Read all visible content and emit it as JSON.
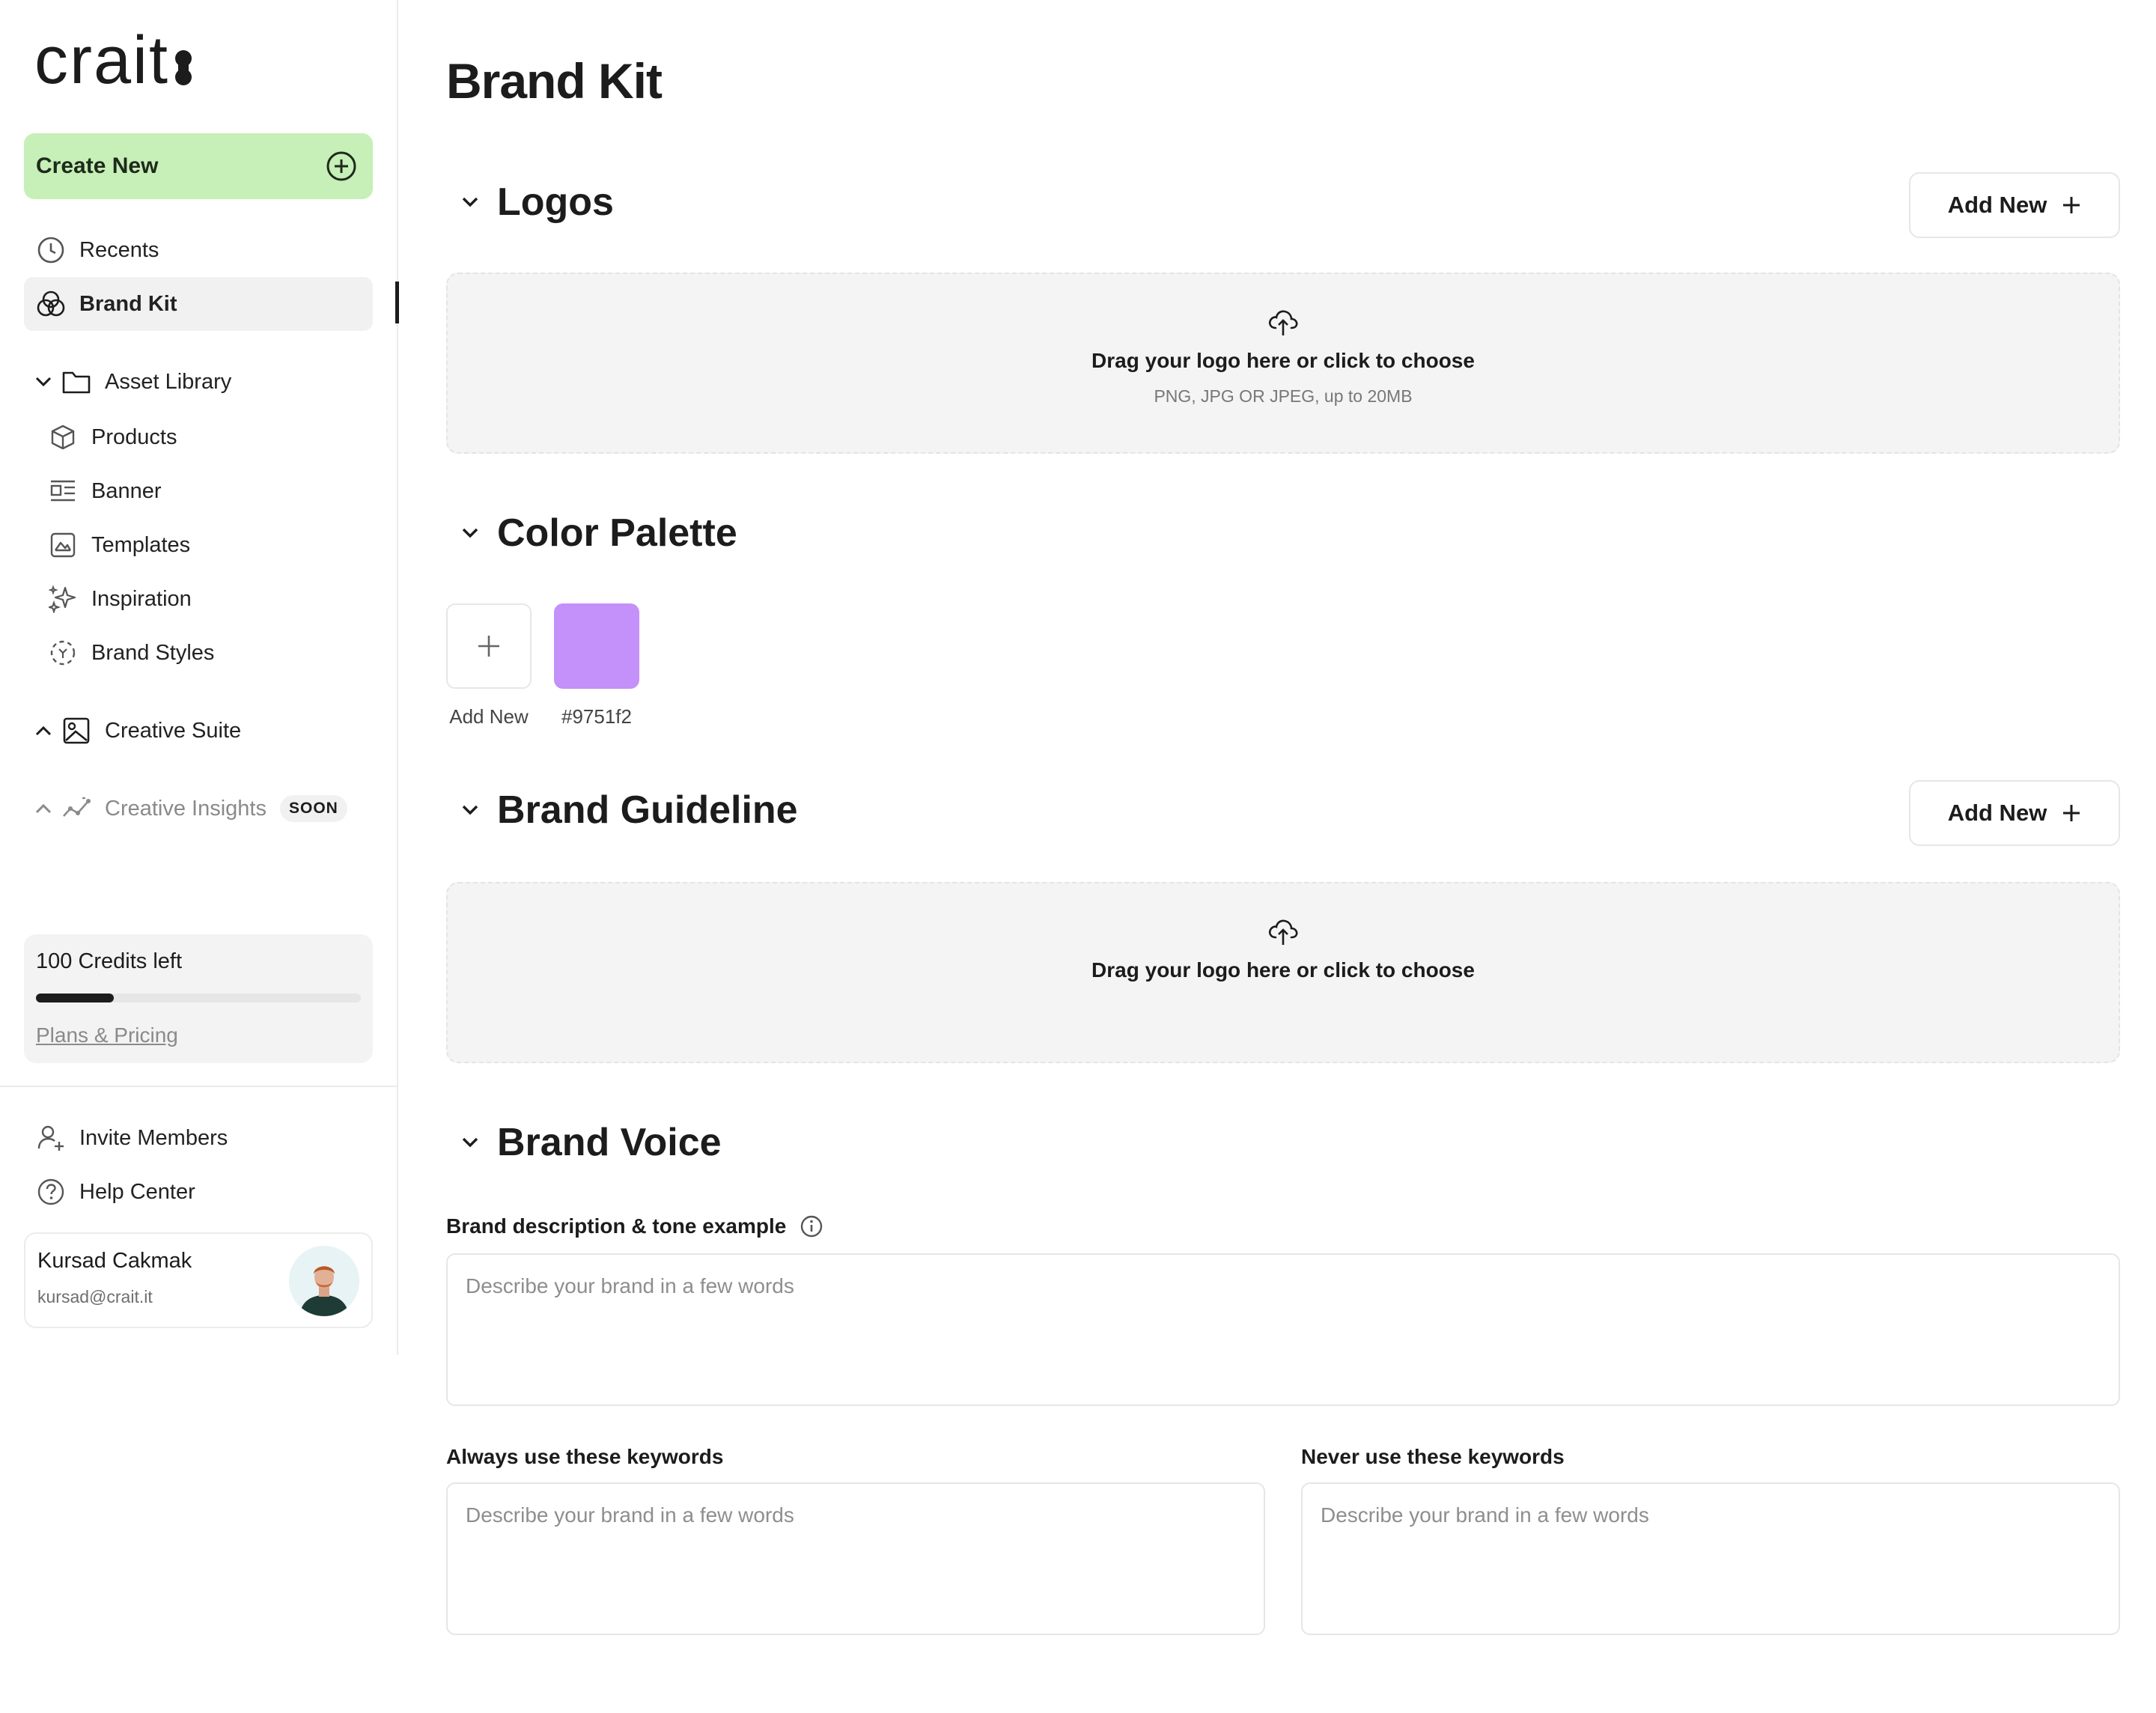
{
  "brand": {
    "logo_text": "crait"
  },
  "sidebar": {
    "create_new": "Create New",
    "nav": {
      "recents": "Recents",
      "brand_kit": "Brand Kit",
      "asset_library": "Asset Library",
      "products": "Products",
      "banner": "Banner",
      "templates": "Templates",
      "inspiration": "Inspiration",
      "brand_styles": "Brand Styles",
      "creative_suite": "Creative Suite",
      "creative_insights": "Creative Insights",
      "soon_badge": "SOON"
    },
    "credits": {
      "text": "100 Credits left",
      "used_fraction": 0.24,
      "plans_link": "Plans & Pricing"
    },
    "footer": {
      "invite": "Invite Members",
      "help": "Help Center"
    },
    "user": {
      "name": "Kursad Cakmak",
      "email": "kursad@crait.it"
    }
  },
  "main": {
    "title": "Brand Kit",
    "logos": {
      "title": "Logos",
      "add_new": "Add New",
      "drop_title": "Drag your logo here or click to choose",
      "drop_sub": "PNG, JPG OR JPEG, up to 20MB"
    },
    "palette": {
      "title": "Color Palette",
      "add_label": "Add New",
      "colors": [
        {
          "hex": "#9751f2",
          "display": "#c490f9"
        }
      ]
    },
    "guideline": {
      "title": "Brand Guideline",
      "add_new": "Add New",
      "drop_title": "Drag your logo here or click to choose"
    },
    "voice": {
      "title": "Brand Voice",
      "desc_label": "Brand description & tone example",
      "desc_placeholder": "Describe your brand in a few words",
      "always_label": "Always use these keywords",
      "always_placeholder": "Describe your brand in a few words",
      "never_label": "Never use these keywords",
      "never_placeholder": "Describe your brand in a few words"
    }
  },
  "colors": {
    "accent_green": "#c7efb8",
    "text": "#1c1c1c"
  }
}
